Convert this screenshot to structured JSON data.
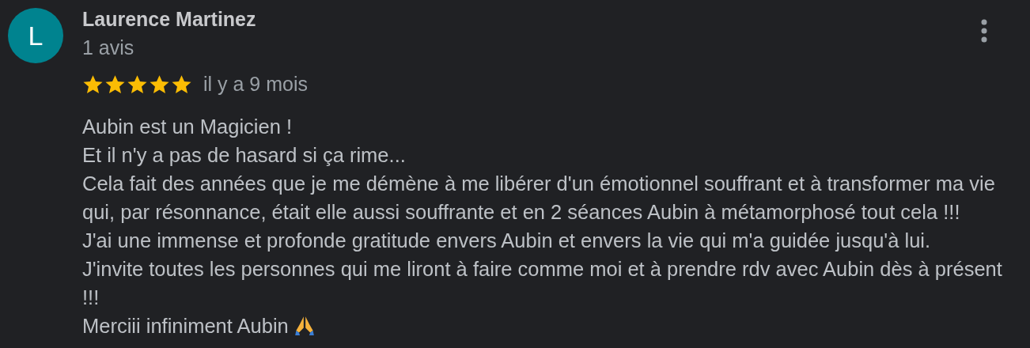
{
  "review": {
    "avatar_letter": "L",
    "author": "Laurence Martinez",
    "author_meta": "1 avis",
    "stars": 5,
    "time": "il y a 9 mois",
    "paragraphs": [
      "Aubin est un Magicien !",
      "Et il n'y a pas de hasard si ça rime...",
      "Cela fait des années que je me démène à me libérer d'un émotionnel souffrant et à transformer ma vie qui, par résonnance, était elle aussi souffrante et en 2 séances Aubin à métamorphosé tout cela !!!",
      "J'ai une immense et profonde gratitude envers Aubin et envers la vie qui m'a guidée jusqu'à lui.",
      "J'invite toutes les personnes qui me liront à faire comme moi et à prendre rdv avec Aubin dès à présent !!!",
      "Merciii infiniment Aubin"
    ]
  }
}
